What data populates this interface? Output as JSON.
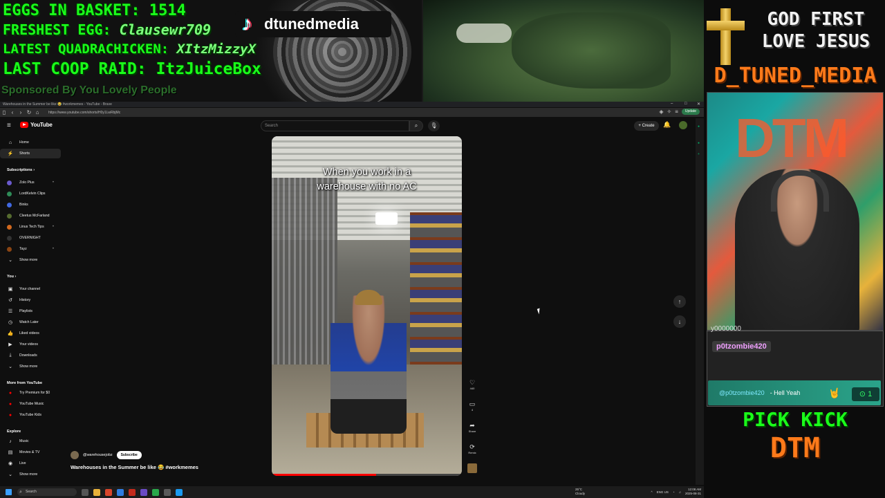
{
  "overlay": {
    "stats": [
      {
        "label": "EGGS IN BASKET: ",
        "value": "1514"
      },
      {
        "label": "FRESHEST EGG: ",
        "value": "Clausewr709"
      },
      {
        "label": "LATEST QUADRACHICKEN: ",
        "value": "XItzMizzyX"
      },
      {
        "label": "LAST COOP RAID: ",
        "value": "ItzJuiceBox"
      }
    ],
    "sponsor": "Sponsored By You Lovely People",
    "tiktok_handle": "dtunedmedia",
    "god_first": "GOD FIRST",
    "love_jesus": "LOVE JESUS",
    "channel": "D_TUNED_MEDIA",
    "chat_blur": "y0000000",
    "chat_user": "p0tzombie420",
    "chat_message_user": "@p0tzombie420",
    "chat_message": "- Hell Yeah",
    "chat_count": "1",
    "pick_kick": "PICK KICK",
    "dtm": "DTM"
  },
  "browser": {
    "window_title": "Warehouses in the Summer be like 😂 #workmemes - YouTube - Brave",
    "url": "https://www.youtube.com/shorts/H0y1LwRbjMc",
    "update_label": "Update"
  },
  "youtube": {
    "logo_text": "YouTube",
    "search_placeholder": "Search",
    "create_label": "Create",
    "sidebar": {
      "main": [
        {
          "label": "Home",
          "icon": "home-icon"
        },
        {
          "label": "Shorts",
          "icon": "shorts-icon",
          "active": true
        }
      ],
      "subscriptions_header": "Subscriptions",
      "subscriptions": [
        {
          "label": "Zolo Plus",
          "color": "#6a5acd"
        },
        {
          "label": "LordKelvin Clips",
          "color": "#2e8b57"
        },
        {
          "label": "Binks",
          "color": "#4169e1"
        },
        {
          "label": "Cleetus McFarland",
          "color": "#556b2f"
        },
        {
          "label": "Linus Tech Tips",
          "color": "#d2691e"
        },
        {
          "label": "OVERNIGHT",
          "color": "#333333"
        },
        {
          "label": "Tayz",
          "color": "#8b4513"
        }
      ],
      "show_more_1": "Show more",
      "you_header": "You",
      "you_items": [
        {
          "label": "Your channel"
        },
        {
          "label": "History"
        },
        {
          "label": "Playlists"
        },
        {
          "label": "Watch Later"
        },
        {
          "label": "Liked videos"
        },
        {
          "label": "Your videos"
        },
        {
          "label": "Downloads"
        }
      ],
      "show_more_2": "Show more",
      "more_header": "More from YouTube",
      "more_items": [
        {
          "label": "Try Premium for $0"
        },
        {
          "label": "YouTube Music"
        },
        {
          "label": "YouTube Kids"
        }
      ],
      "explore_header": "Explore",
      "explore_items": [
        {
          "label": "Music"
        },
        {
          "label": "Movies & TV"
        },
        {
          "label": "Live"
        }
      ],
      "show_more_3": "Show more"
    },
    "short": {
      "caption_line1": "When you work in a",
      "caption_line2": "warehouse with no AC",
      "progress": 0.55,
      "channel": "@warehousejobz",
      "subscribe_label": "Subscribe",
      "title": "Warehouses in the Summer be like 😂 #workmemes",
      "likes": "440",
      "comments": "4",
      "share_label": "Share",
      "remix_label": "Remix"
    }
  },
  "taskbar": {
    "search_placeholder": "Search",
    "weather_temp": "25°C",
    "weather_desc": "Cloudy",
    "lang": "ENG US",
    "time": "12:08 AM",
    "date": "2025-08-31"
  }
}
